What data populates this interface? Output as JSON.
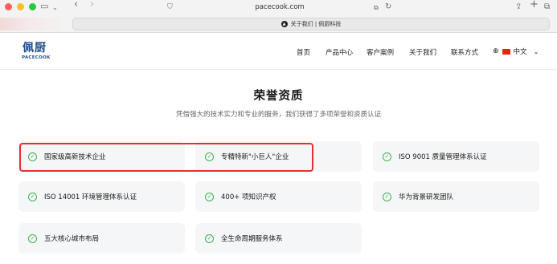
{
  "browser": {
    "url": "pacecook.com",
    "tab_title": "关于我们 | 佩厨科技",
    "tab_favicon": "▲"
  },
  "logo": {
    "name_cn": "佩厨",
    "name_en": "PACECOOK"
  },
  "nav": [
    {
      "label": "首页"
    },
    {
      "label": "产品中心"
    },
    {
      "label": "客户案例"
    },
    {
      "label": "关于我们"
    },
    {
      "label": "联系方式"
    }
  ],
  "language": {
    "label": "中文"
  },
  "section": {
    "title": "荣誉资质",
    "subtitle": "凭借强大的技术实力和专业的服务，我们获得了多项荣誉和资质认证"
  },
  "honors": [
    {
      "label": "国家级高新技术企业"
    },
    {
      "label": "专精特新\"小巨人\"企业"
    },
    {
      "label": "ISO 9001 质量管理体系认证"
    },
    {
      "label": "ISO 14001 环境管理体系认证"
    },
    {
      "label": "400+ 项知识产权"
    },
    {
      "label": "华为背景研发团队"
    },
    {
      "label": "五大核心城市布局"
    },
    {
      "label": "全生命周期服务体系"
    }
  ],
  "colors": {
    "accent_check": "#3fb24f",
    "highlight_box": "#e53030",
    "brand_blue": "#1f4f8a",
    "card_bg": "#f5f6f7"
  }
}
